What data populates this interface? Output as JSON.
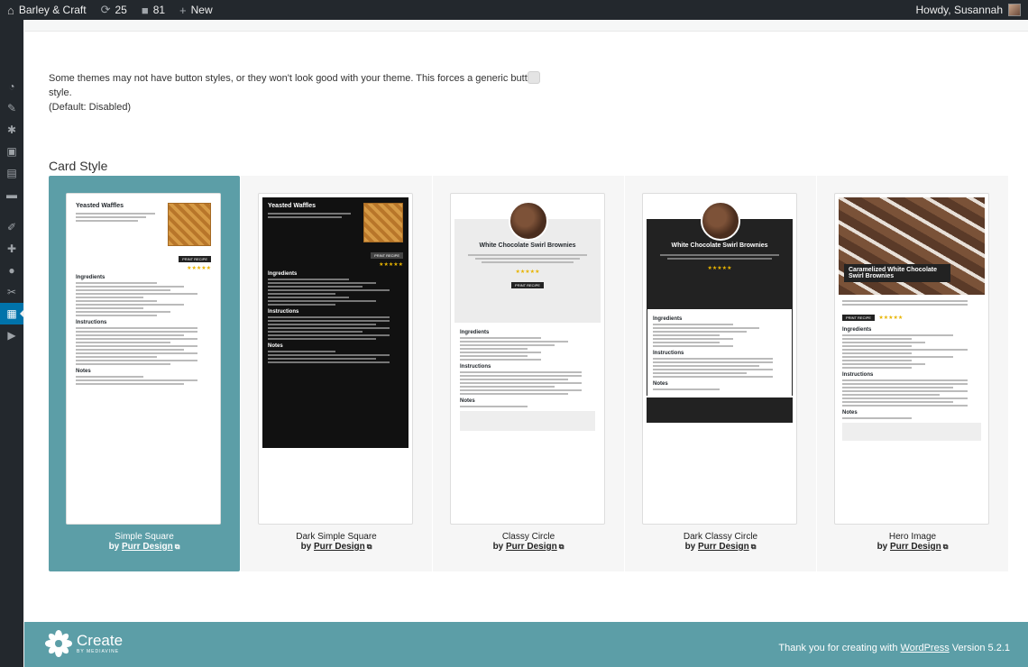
{
  "adminbar": {
    "site_name": "Barley & Craft",
    "updates": "25",
    "comments": "81",
    "new_label": "New",
    "greeting": "Howdy, Susannah"
  },
  "setting": {
    "description": "Some themes may not have button styles, or they won't look good with your theme. This forces a generic button style.",
    "default": "(Default: Disabled)"
  },
  "section_title": "Card Style",
  "cards": [
    {
      "name": "Simple Square",
      "by": "by",
      "author": "Purr Design",
      "selected": true
    },
    {
      "name": "Dark Simple Square",
      "by": "by",
      "author": "Purr Design",
      "selected": false
    },
    {
      "name": "Classy Circle",
      "by": "by",
      "author": "Purr Design",
      "selected": false
    },
    {
      "name": "Dark Classy Circle",
      "by": "by",
      "author": "Purr Design",
      "selected": false
    },
    {
      "name": "Hero Image",
      "by": "by",
      "author": "Purr Design",
      "selected": false
    }
  ],
  "previews": {
    "waffles_title": "Yeasted Waffles",
    "brownies_title": "White Chocolate Swirl Brownies",
    "hero_title": "Caramelized White Chocolate Swirl Brownies",
    "ingredients": "Ingredients",
    "instructions": "Instructions",
    "notes": "Notes",
    "print": "PRINT RECIPE"
  },
  "footer": {
    "logo_text": "Create",
    "logo_sub": "BY MEDIAVINE",
    "thanks_prefix": "Thank you for creating with",
    "wordpress": "WordPress",
    "version": "Version 5.2.1"
  },
  "colors": {
    "accent": "#5c9ea7",
    "admin_bar": "#23282d",
    "active_menu": "#0073aa"
  }
}
